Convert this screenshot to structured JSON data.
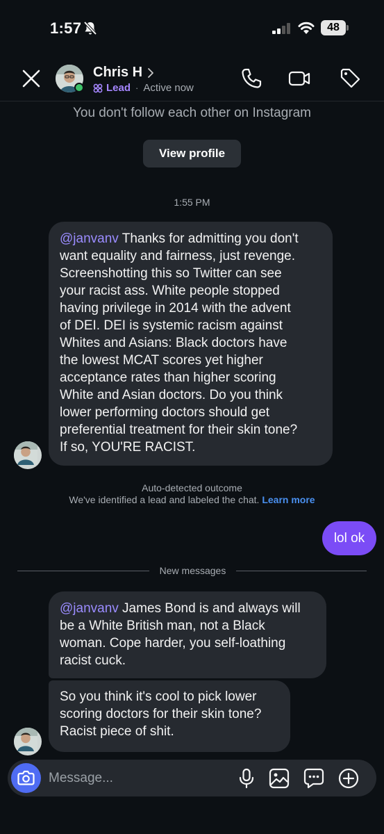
{
  "status_bar": {
    "time": "1:57",
    "battery": "48"
  },
  "header": {
    "contact_name": "Chris H",
    "lead_label": "Lead",
    "separator": "·",
    "status": "Active now"
  },
  "chat": {
    "follow_note": "You don't follow each other on Instagram",
    "view_profile_label": "View profile",
    "timestamp": "1:55 PM",
    "messages": [
      {
        "mention": "@janvanv",
        "text": " Thanks for admitting you don't\nwant equality and fairness, just revenge.\nScreenshotting this so Twitter can see\nyour racist ass. White people stopped\nhaving privilege in 2014 with the advent\nof DEI. DEI is systemic racism against\nWhites and Asians: Black doctors have\nthe lowest MCAT scores yet higher\nacceptance rates than higher scoring\nWhite and Asian doctors. Do you think\nlower performing doctors should get\npreferential treatment for their skin tone?\nIf so, YOU'RE RACIST."
      },
      {
        "mention": "@janvanv",
        "text": " James Bond is and always will\nbe a White British man, not a Black\nwoman. Cope harder, you self-loathing\nracist cuck."
      },
      {
        "text": "So you think it's cool to pick lower\nscoring doctors for their skin tone?\nRacist piece of shit."
      }
    ],
    "auto_detect_title": "Auto-detected outcome",
    "auto_detect_text": "We've identified a lead and labeled the chat.",
    "learn_more": "Learn more",
    "sent_message": "lol ok",
    "new_messages_label": "New messages"
  },
  "composer": {
    "placeholder": "Message..."
  },
  "colors": {
    "background": "#0c1014",
    "bubble": "#262a30",
    "sent_bubble": "#7b4cf6",
    "mention": "#9b8cff",
    "lead": "#a586ff",
    "link": "#4a90f0",
    "online": "#3ec26a"
  },
  "icons": [
    "bell-slash-icon",
    "signal-icon",
    "wifi-icon",
    "battery-icon",
    "close-icon",
    "chevron-right-icon",
    "lead-icon",
    "phone-icon",
    "video-icon",
    "tag-icon",
    "camera-icon",
    "microphone-icon",
    "gallery-icon",
    "sticker-icon",
    "plus-icon"
  ]
}
